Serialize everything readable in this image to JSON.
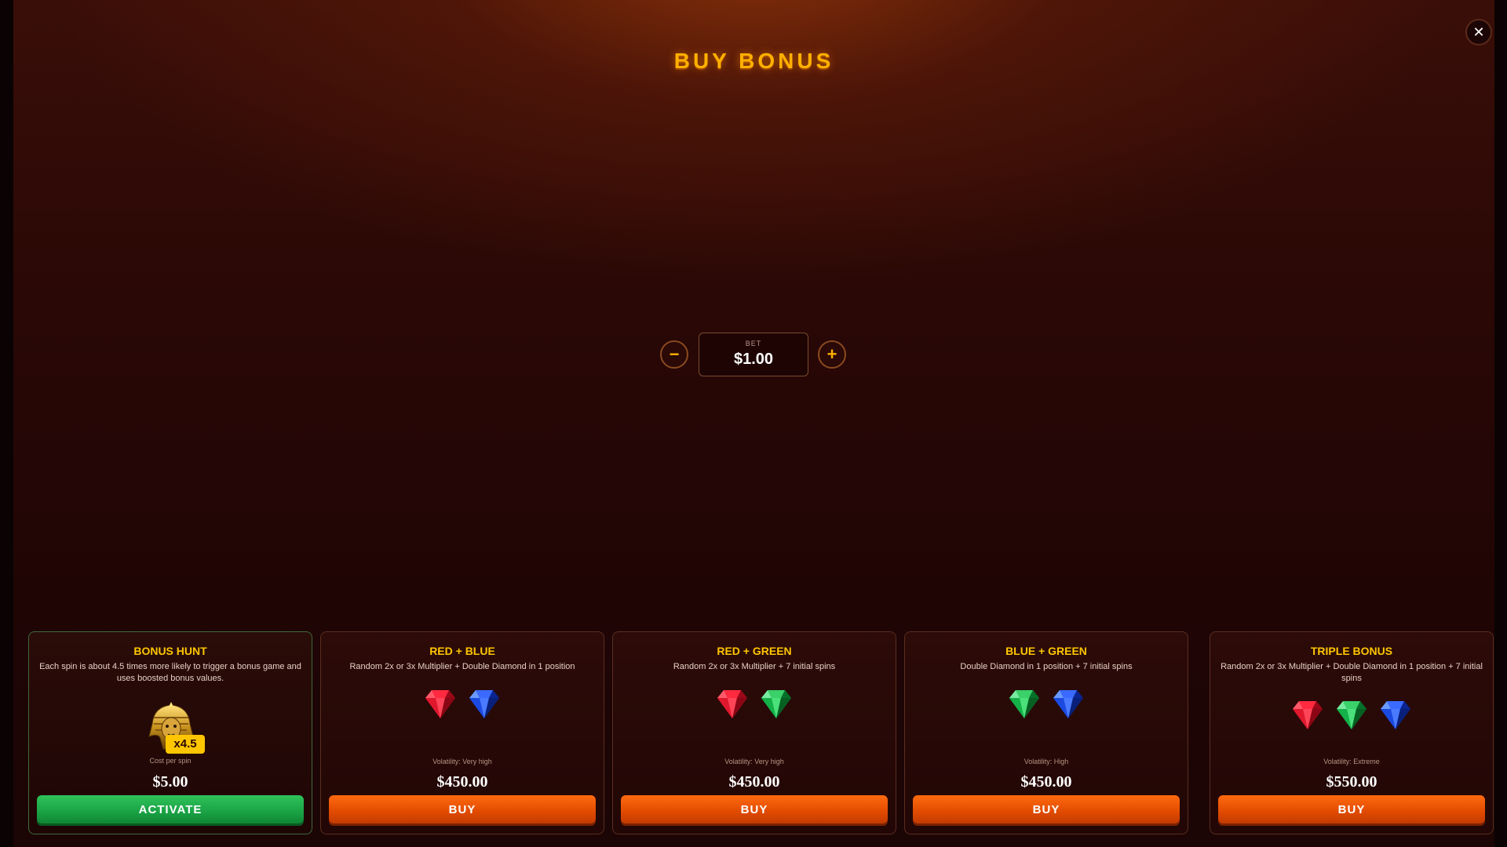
{
  "header": {
    "title": "BUY BONUS"
  },
  "close": {
    "glyph": "✕"
  },
  "bet": {
    "label": "BET",
    "value": "$1.00",
    "minus": "−",
    "plus": "+"
  },
  "cards": [
    {
      "title": "BONUS HUNT",
      "description": "Each spin is about 4.5 times more likely to trigger a bonus game and uses boosted bonus values.",
      "multiplier": "x4.5",
      "cost_label": "Cost per spin",
      "price": "$5.00",
      "button": "ACTIVATE",
      "icon": "golden-pharaoh-icon"
    },
    {
      "title": "RED + BLUE",
      "description": "Random 2x or 3x Multiplier + Double Diamond in 1 position",
      "gems": [
        "red",
        "blue"
      ],
      "volatility": "Volatility: Very high",
      "price": "$450.00",
      "button": "BUY"
    },
    {
      "title": "RED + GREEN",
      "description": "Random 2x or 3x Multiplier + 7 initial spins",
      "gems": [
        "red",
        "green"
      ],
      "volatility": "Volatility: Very high",
      "price": "$450.00",
      "button": "BUY"
    },
    {
      "title": "BLUE + GREEN",
      "description": "Double Diamond in 1 position + 7 initial spins",
      "gems": [
        "green",
        "blue"
      ],
      "volatility": "Volatility: High",
      "price": "$450.00",
      "button": "BUY"
    },
    {
      "title": "TRIPLE BONUS",
      "description": "Random 2x or 3x Multiplier + Double Diamond in 1 position + 7 initial spins",
      "gems": [
        "red",
        "green",
        "blue"
      ],
      "volatility": "Volatility: Extreme",
      "price": "$550.00",
      "button": "BUY"
    }
  ],
  "colors": {
    "gold": "#ffc600",
    "buy": "#e04a00",
    "activate": "#1aa245",
    "red_gem": "#e0112a",
    "blue_gem": "#1646e0",
    "green_gem": "#12b04a"
  }
}
